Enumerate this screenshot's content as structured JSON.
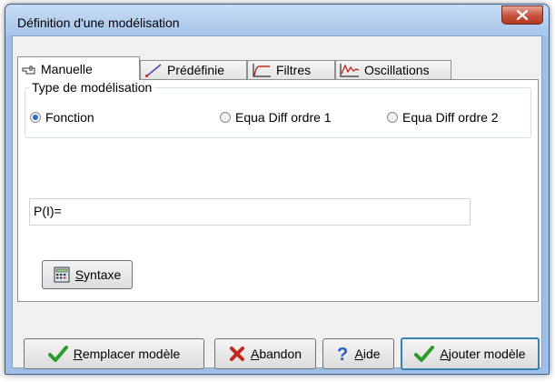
{
  "window": {
    "title": "Définition d'une modélisation"
  },
  "tabs": [
    {
      "label": "Manuelle",
      "icon": "hand-pointer-icon",
      "active": true
    },
    {
      "label": "Prédéfinie",
      "icon": "line-chart-icon",
      "active": false
    },
    {
      "label": "Filtres",
      "icon": "filter-curve-icon",
      "active": false
    },
    {
      "label": "Oscillations",
      "icon": "oscillation-icon",
      "active": false
    }
  ],
  "group": {
    "label": "Type de modélisation",
    "options": [
      {
        "label": "Fonction",
        "checked": true
      },
      {
        "label": "Equa Diff ordre 1",
        "checked": false
      },
      {
        "label": "Equa Diff ordre 2",
        "checked": false
      }
    ]
  },
  "formula": {
    "value": "P(I)="
  },
  "syntax_button": {
    "accel": "S",
    "rest": "yntaxe"
  },
  "buttons": {
    "replace": {
      "accel": "R",
      "rest": "emplacer modèle"
    },
    "abandon": {
      "accel": "A",
      "rest": "bandon"
    },
    "help": {
      "accel": "A",
      "rest": "ide"
    },
    "add": {
      "accel": "A",
      "rest": "jouter modèle"
    }
  },
  "colors": {
    "titlebar": "#b7d1f0",
    "close": "#c7503b",
    "check_green": "#2a9a2a",
    "cross_red": "#c0291d",
    "help_blue": "#1e5cc6"
  }
}
